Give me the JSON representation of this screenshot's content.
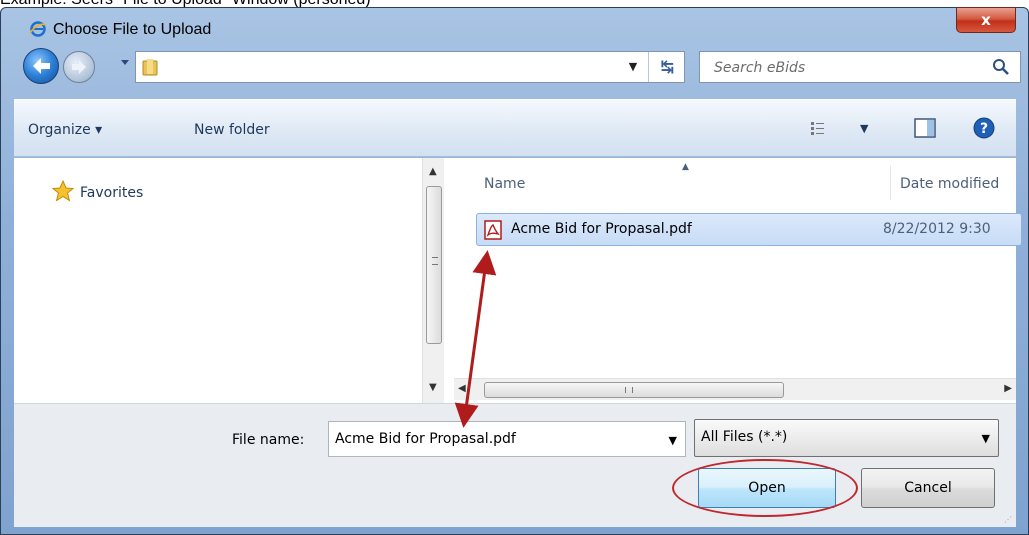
{
  "caption": "Example: Seers \"File to Upload\" Window (personed)",
  "window": {
    "title": "Choose File to Upload",
    "close_label": "x"
  },
  "address_bar": {
    "path": "",
    "search_placeholder": "Search eBids"
  },
  "toolbar": {
    "organize_label": "Organize ▾",
    "new_folder_label": "New folder"
  },
  "nav_pane": {
    "items": [
      {
        "label": "Favorites",
        "icon": "star-icon"
      }
    ]
  },
  "file_list": {
    "columns": [
      "Name",
      "Date modified"
    ],
    "rows": [
      {
        "name": "Acme Bid for Propasal.pdf",
        "date_modified": "8/22/2012 9:30",
        "icon": "pdf-icon",
        "selected": true
      }
    ]
  },
  "bottom": {
    "file_name_label": "File name:",
    "file_name_value": "Acme Bid for Propasal.pdf",
    "file_type_value": "All Files (*.*)",
    "open_label": "Open",
    "cancel_label": "Cancel"
  },
  "colors": {
    "annotation": "#c0282d",
    "selection": "#c7dcf6",
    "frame": "#8fb0d8"
  }
}
